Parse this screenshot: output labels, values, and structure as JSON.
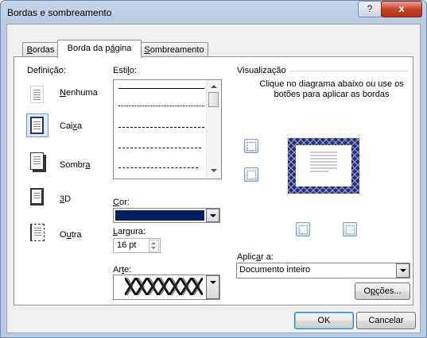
{
  "window": {
    "title": "Bordas e sombreamento",
    "help_label": "?",
    "close_label": "x"
  },
  "tabs": [
    {
      "label_pre": "",
      "label_acc": "B",
      "label_post": "ordas"
    },
    {
      "label_pre": "Borda da p",
      "label_acc": "á",
      "label_post": "gina"
    },
    {
      "label_pre": "",
      "label_acc": "S",
      "label_post": "ombreamento"
    }
  ],
  "definition": {
    "header": "Definição:",
    "items": [
      {
        "pre": "",
        "acc": "N",
        "post": "enhuma",
        "selected": false
      },
      {
        "pre": "Cai",
        "acc": "x",
        "post": "a",
        "selected": true
      },
      {
        "pre": "Sombr",
        "acc": "a",
        "post": "",
        "selected": false
      },
      {
        "pre": "",
        "acc": "3",
        "post": "D",
        "selected": false
      },
      {
        "pre": "O",
        "acc": "u",
        "post": "tra",
        "selected": false
      }
    ]
  },
  "style": {
    "header_pre": "Esti",
    "header_acc": "l",
    "header_post": "o:"
  },
  "color": {
    "label_pre": "",
    "label_acc": "C",
    "label_post": "or:",
    "value": "#002060"
  },
  "width": {
    "label_pre": "",
    "label_acc": "L",
    "label_post": "argura:",
    "value": "16 pt"
  },
  "art": {
    "label_pre": "Ar",
    "label_acc": "t",
    "label_post": "e:"
  },
  "preview": {
    "header": "Visualização",
    "instructions": "Clique no diagrama abaixo ou use os botões para aplicar as bordas"
  },
  "apply_to": {
    "label_pre": "Aplic",
    "label_acc": "a",
    "label_post": "r a:",
    "value": "Documento inteiro"
  },
  "buttons": {
    "options_pre": "O",
    "options_acc": "p",
    "options_post": "ções...",
    "ok": "OK",
    "cancel": "Cancelar"
  },
  "colors": {
    "accent": "#002060",
    "art_pattern": "#3b3f7a"
  }
}
